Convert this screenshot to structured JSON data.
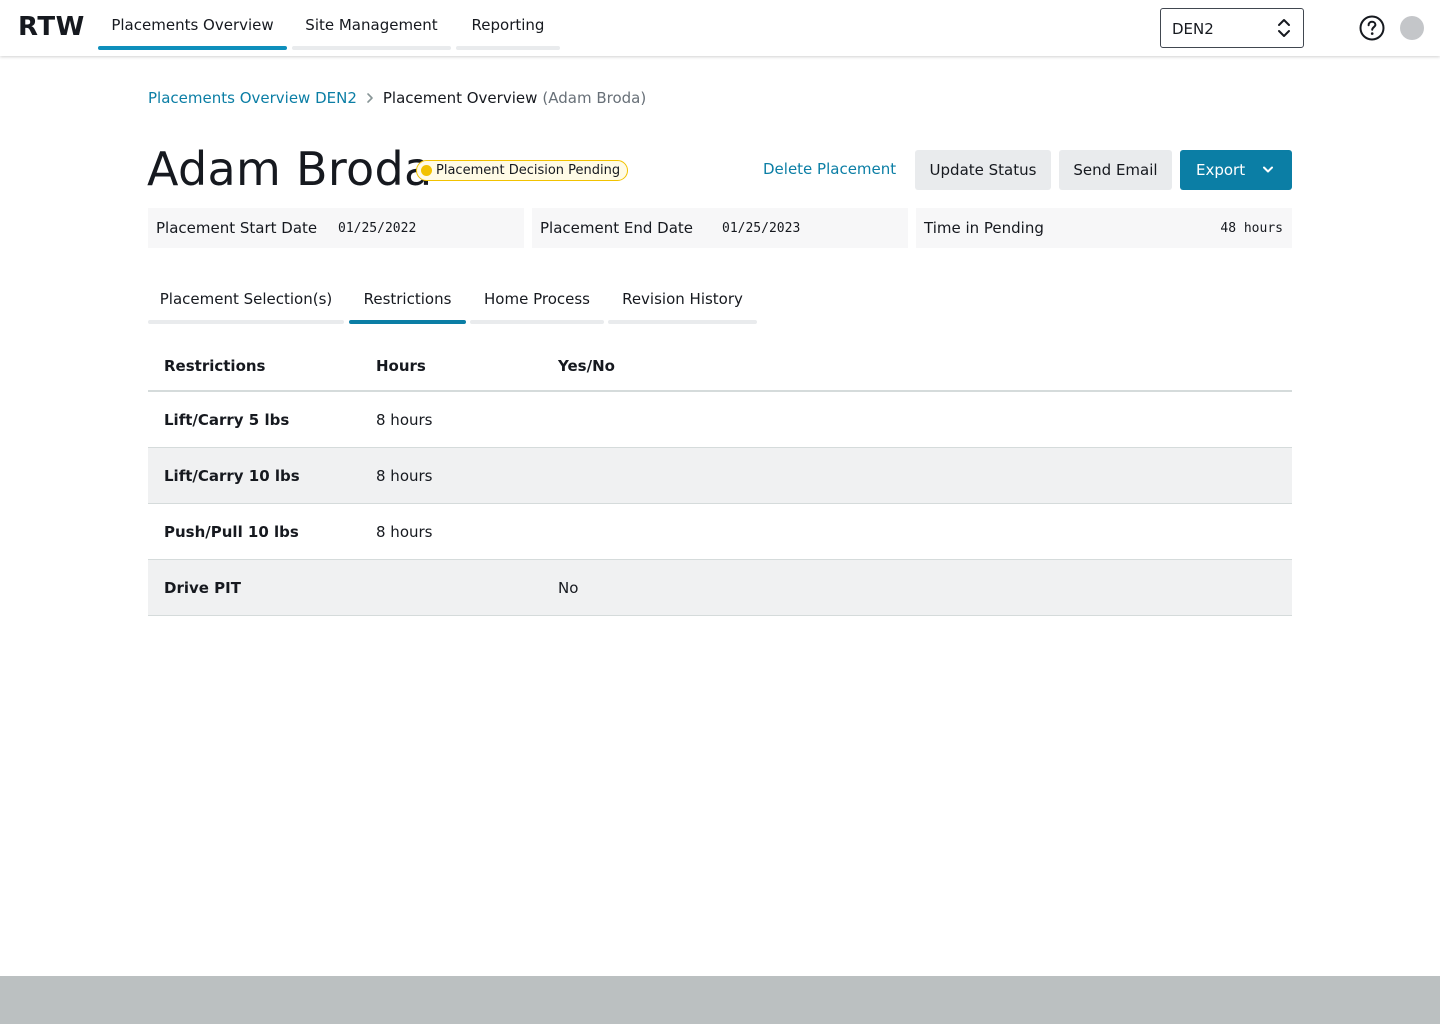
{
  "app": {
    "logo": "RTW"
  },
  "nav": {
    "tabs": [
      {
        "label": "Placements Overview",
        "active": true
      },
      {
        "label": "Site Management",
        "active": false
      },
      {
        "label": "Reporting",
        "active": false
      }
    ],
    "site_selector": {
      "value": "DEN2",
      "icon": "chevron-up-down-icon"
    },
    "help_icon": "question-circle-icon",
    "avatar_icon": "user-avatar"
  },
  "breadcrumb": {
    "parent": "Placements Overview DEN2",
    "separator_icon": "chevron-right-icon",
    "current": "Placement Overview",
    "current_sub": "(Adam Broda)"
  },
  "header": {
    "name": "Adam Broda",
    "status_badge": "Placement Decision Pending",
    "status_color": "#f2c200",
    "actions": {
      "delete": "Delete Placement",
      "update": "Update Status",
      "email": "Send Email",
      "export": "Export"
    },
    "accent_color": "#0b7ea5"
  },
  "info": {
    "start": {
      "label": "Placement Start Date",
      "value": "01/25/2022"
    },
    "end": {
      "label": "Placement End Date",
      "value": "01/25/2023"
    },
    "pending": {
      "label": "Time in Pending",
      "value": "48 hours"
    }
  },
  "tabs": [
    {
      "label": "Placement Selection(s)",
      "active": false
    },
    {
      "label": "Restrictions",
      "active": true
    },
    {
      "label": "Home Process",
      "active": false
    },
    {
      "label": "Revision History",
      "active": false
    }
  ],
  "restrictions_table": {
    "columns": [
      "Restrictions",
      "Hours",
      "Yes/No"
    ],
    "rows": [
      {
        "restriction": "Lift/Carry 5 lbs",
        "hours": "8 hours",
        "yes_no": ""
      },
      {
        "restriction": "Lift/Carry 10 lbs",
        "hours": "8 hours",
        "yes_no": ""
      },
      {
        "restriction": "Push/Pull 10 lbs",
        "hours": "8 hours",
        "yes_no": ""
      },
      {
        "restriction": "Drive PIT",
        "hours": "",
        "yes_no": "No"
      }
    ]
  }
}
